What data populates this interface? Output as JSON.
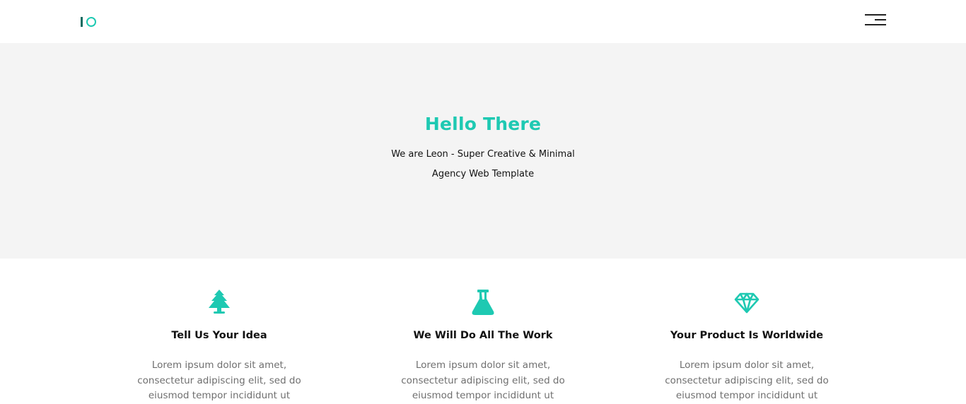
{
  "brand": {
    "accent_color": "#1ec9b2"
  },
  "header": {
    "menu_icon": "hamburger-menu-icon"
  },
  "hero": {
    "title": "Hello There",
    "subtitle_line1": "We are Leon - Super Creative & Minimal",
    "subtitle_line2": "Agency Web Template"
  },
  "features": [
    {
      "icon": "tree-icon",
      "title": "Tell Us Your Idea",
      "text_lines": [
        "Lorem ipsum dolor sit amet,",
        "consectetur adipiscing elit, sed do",
        "eiusmod tempor incididunt ut"
      ]
    },
    {
      "icon": "flask-icon",
      "title": "We Will Do All The Work",
      "text_lines": [
        "Lorem ipsum dolor sit amet,",
        "consectetur adipiscing elit, sed do",
        "eiusmod tempor incididunt ut"
      ]
    },
    {
      "icon": "diamond-icon",
      "title": "Your Product Is Worldwide",
      "text_lines": [
        "Lorem ipsum dolor sit amet,",
        "consectetur adipiscing elit, sed do",
        "eiusmod tempor incididunt ut"
      ]
    }
  ]
}
